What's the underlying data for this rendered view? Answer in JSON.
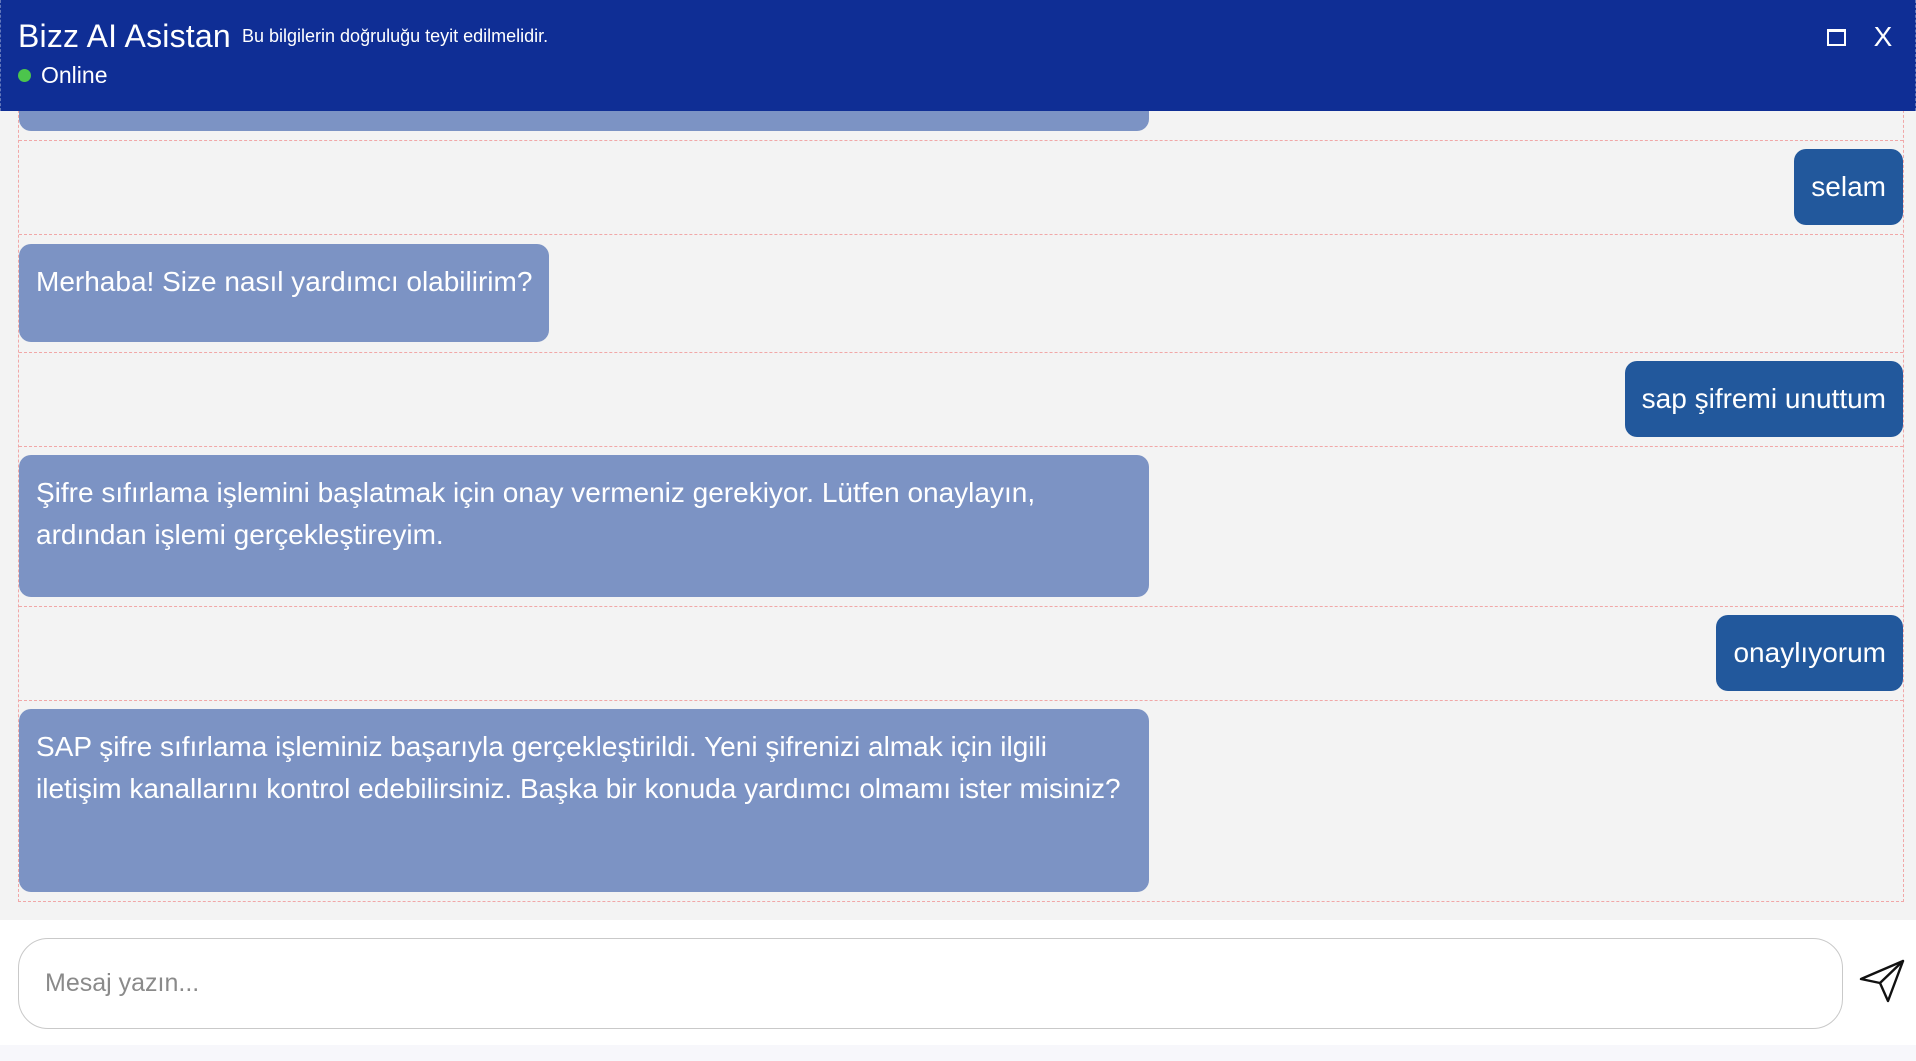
{
  "header": {
    "title": "Bizz AI Asistan",
    "disclaimer": "Bu bilgilerin doğruluğu teyit edilmelidir.",
    "status": "Online",
    "colors": {
      "background": "#0f2e95",
      "status_dot": "#4cc54c"
    },
    "icons": {
      "maximize": "maximize-icon",
      "close": "close-icon"
    },
    "close_label": "X"
  },
  "messages": [
    {
      "sender": "bot",
      "text": ""
    },
    {
      "sender": "user",
      "text": "selam"
    },
    {
      "sender": "bot",
      "text": "Merhaba! Size nasıl yardımcı olabilirim?"
    },
    {
      "sender": "user",
      "text": "sap şifremi unuttum"
    },
    {
      "sender": "bot",
      "text": "Şifre sıfırlama işlemini başlatmak için onay vermeniz gerekiyor. Lütfen onaylayın, ardından işlemi gerçekleştireyim."
    },
    {
      "sender": "user",
      "text": "onaylıyorum"
    },
    {
      "sender": "bot",
      "text": "SAP şifre sıfırlama işleminiz başarıyla gerçekleştirildi. Yeni şifrenizi almak için ilgili iletişim kanallarını kontrol edebilirsiniz. Başka bir konuda yardımcı olmamı ister misiniz?"
    }
  ],
  "colors": {
    "bot_bubble": "#7c93c4",
    "user_bubble": "#22589c"
  },
  "composer": {
    "value": "",
    "placeholder": "Mesaj yazın...",
    "send_icon": "send-icon"
  }
}
